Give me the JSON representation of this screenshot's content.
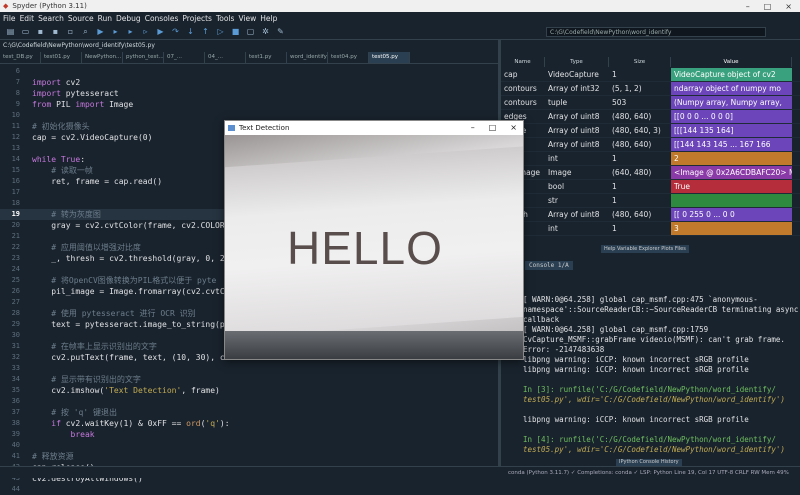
{
  "window": {
    "title": "Spyder (Python 3.11)",
    "controls": [
      "–",
      "□",
      "×"
    ]
  },
  "menu": [
    "File",
    "Edit",
    "Search",
    "Source",
    "Run",
    "Debug",
    "Consoles",
    "Projects",
    "Tools",
    "View",
    "Help"
  ],
  "toolbar": {
    "path": "C:\\G\\Codefield\\NewPython\\word_identify"
  },
  "editor": {
    "filepath": "C:\\G\\Codefield\\NewPython\\word_identify\\test05.py",
    "tabs": [
      "test_DB.py",
      "test01.py",
      "NewPython...",
      "python_test...",
      "07_...",
      "04_...",
      "test1.py",
      "word_identify",
      "test04.py",
      "test05.py"
    ],
    "active_tab": 9,
    "lines": [
      {
        "n": "6",
        "t": ""
      },
      {
        "n": "7",
        "t": "import cv2"
      },
      {
        "n": "8",
        "t": "import pytesseract"
      },
      {
        "n": "9",
        "t": "from PIL import Image"
      },
      {
        "n": "10",
        "t": ""
      },
      {
        "n": "11",
        "t": "# 初始化摄像头"
      },
      {
        "n": "12",
        "t": "cap = cv2.VideoCapture(0)"
      },
      {
        "n": "13",
        "t": ""
      },
      {
        "n": "14",
        "t": "while True:"
      },
      {
        "n": "15",
        "t": "    # 读取一帧"
      },
      {
        "n": "16",
        "t": "    ret, frame = cap.read()"
      },
      {
        "n": "17",
        "t": ""
      },
      {
        "n": "18",
        "t": ""
      },
      {
        "n": "19",
        "t": "    # 转为灰度图"
      },
      {
        "n": "20",
        "t": "    gray = cv2.cvtColor(frame, cv2.COLOR"
      },
      {
        "n": "21",
        "t": ""
      },
      {
        "n": "22",
        "t": "    # 应用阈值以增强对比度"
      },
      {
        "n": "23",
        "t": "    _, thresh = cv2.threshold(gray, 0, 25"
      },
      {
        "n": "24",
        "t": ""
      },
      {
        "n": "25",
        "t": "    # 将OpenCV图像转换为PIL格式以便于 pyte"
      },
      {
        "n": "26",
        "t": "    pil_image = Image.fromarray(cv2.cvtCo"
      },
      {
        "n": "27",
        "t": ""
      },
      {
        "n": "28",
        "t": "    # 使用 pytesseract 进行 OCR 识别"
      },
      {
        "n": "29",
        "t": "    text = pytesseract.image_to_string(pi"
      },
      {
        "n": "30",
        "t": ""
      },
      {
        "n": "31",
        "t": "    # 在帧率上显示识别出的文字"
      },
      {
        "n": "32",
        "t": "    cv2.putText(frame, text, (10, 30), cv"
      },
      {
        "n": "33",
        "t": ""
      },
      {
        "n": "34",
        "t": "    # 显示带有识别出的文字"
      },
      {
        "n": "35",
        "t": "    cv2.imshow('Text Detection', frame)"
      },
      {
        "n": "36",
        "t": ""
      },
      {
        "n": "37",
        "t": "    # 按 'q' 键退出"
      },
      {
        "n": "38",
        "t": "    if cv2.waitKey(1) & 0xFF == ord('q'):"
      },
      {
        "n": "39",
        "t": "        break"
      },
      {
        "n": "40",
        "t": ""
      },
      {
        "n": "41",
        "t": "# 释放资源"
      },
      {
        "n": "42",
        "t": "cap.release()"
      },
      {
        "n": "43",
        "t": "cv2.destroyAllWindows()"
      },
      {
        "n": "44",
        "t": ""
      }
    ],
    "current_line": "19"
  },
  "variables": {
    "headers": [
      "Name",
      "Type",
      "Size",
      "Value"
    ],
    "rows": [
      {
        "name": "cap",
        "type": "VideoCapture",
        "size": "1",
        "value": "VideoCapture object of cv2",
        "color": "#3aa17e"
      },
      {
        "name": "contours",
        "type": "Array of int32",
        "size": "(5, 1, 2)",
        "value": "ndarray object of numpy mo",
        "color": "#6b45b9"
      },
      {
        "name": "contours",
        "type": "tuple",
        "size": "503",
        "value": "(Numpy array, Numpy array,",
        "color": "#6b45b9"
      },
      {
        "name": "edges",
        "type": "Array of uint8",
        "size": "(480, 640)",
        "value": "[[0 0 0 ... 0 0 0]",
        "color": "#6b45b9"
      },
      {
        "name": "frame",
        "type": "Array of uint8",
        "size": "(480, 640, 3)",
        "value": "[[[144 135 164]",
        "color": "#6b45b9"
      },
      {
        "name": "gray",
        "type": "Array of uint8",
        "size": "(480, 640)",
        "value": "[[144 143 145 ... 167 166",
        "color": "#6b45b9"
      },
      {
        "name": "i",
        "type": "int",
        "size": "1",
        "value": "2",
        "color": "#c17a2c"
      },
      {
        "name": "pil_image",
        "type": "Image",
        "size": "(640, 480)",
        "value": "<Image @ 0x2A6CDBAFC20>  M...",
        "color": "#8a3aa6"
      },
      {
        "name": "ret",
        "type": "bool",
        "size": "1",
        "value": "True",
        "color": "#b52c3a"
      },
      {
        "name": "text",
        "type": "str",
        "size": "1",
        "value": "",
        "color": "#2e8a3e"
      },
      {
        "name": "thresh",
        "type": "Array of uint8",
        "size": "(480, 640)",
        "value": "[[  0 255   0 ...  0   0",
        "color": "#6b45b9"
      },
      {
        "name": "x",
        "type": "int",
        "size": "1",
        "value": "3",
        "color": "#c17a2c"
      }
    ],
    "tabs": "Help  Variable Explorer  Plots  Files"
  },
  "console": {
    "tab": "Console 1/A",
    "lines": [
      {
        "text": "[ WARN:0@64.258] global cap_msmf.cpp:475 `anonymous-",
        "cls": ""
      },
      {
        "text": "namespace'::SourceReaderCB::~SourceReaderCB terminating async",
        "cls": ""
      },
      {
        "text": "callback",
        "cls": ""
      },
      {
        "text": "[ WARN:0@64.258] global cap_msmf.cpp:1759",
        "cls": ""
      },
      {
        "text": "CvCapture_MSMF::grabFrame videoio(MSMF): can't grab frame.",
        "cls": ""
      },
      {
        "text": "Error: -2147483638",
        "cls": ""
      },
      {
        "text": "libpng warning: iCCP: known incorrect sRGB profile",
        "cls": ""
      },
      {
        "text": "libpng warning: iCCP: known incorrect sRGB profile",
        "cls": ""
      },
      {
        "text": "",
        "cls": ""
      },
      {
        "text": "In [3]: runfile('C:/G/Codefield/NewPython/word_identify/",
        "cls": "green"
      },
      {
        "text": "test05.py', wdir='C:/G/Codefield/NewPython/word_identify')",
        "cls": "ital"
      },
      {
        "text": "",
        "cls": ""
      },
      {
        "text": "libpng warning: iCCP: known incorrect sRGB profile",
        "cls": ""
      },
      {
        "text": "",
        "cls": ""
      },
      {
        "text": "In [4]: runfile('C:/G/Codefield/NewPython/word_identify/",
        "cls": "green"
      },
      {
        "text": "test05.py', wdir='C:/G/Codefield/NewPython/word_identify')",
        "cls": "ital"
      }
    ]
  },
  "status": "conda (Python 3.11.7)   ✓ Completions: conda   ✓ LSP: Python   Line 19, Col 17   UTF-8   CRLF   RW   Mem 49%",
  "console_tabs": "IPython Console  History",
  "camera": {
    "title": "Text Detection",
    "text": "HELLO"
  }
}
